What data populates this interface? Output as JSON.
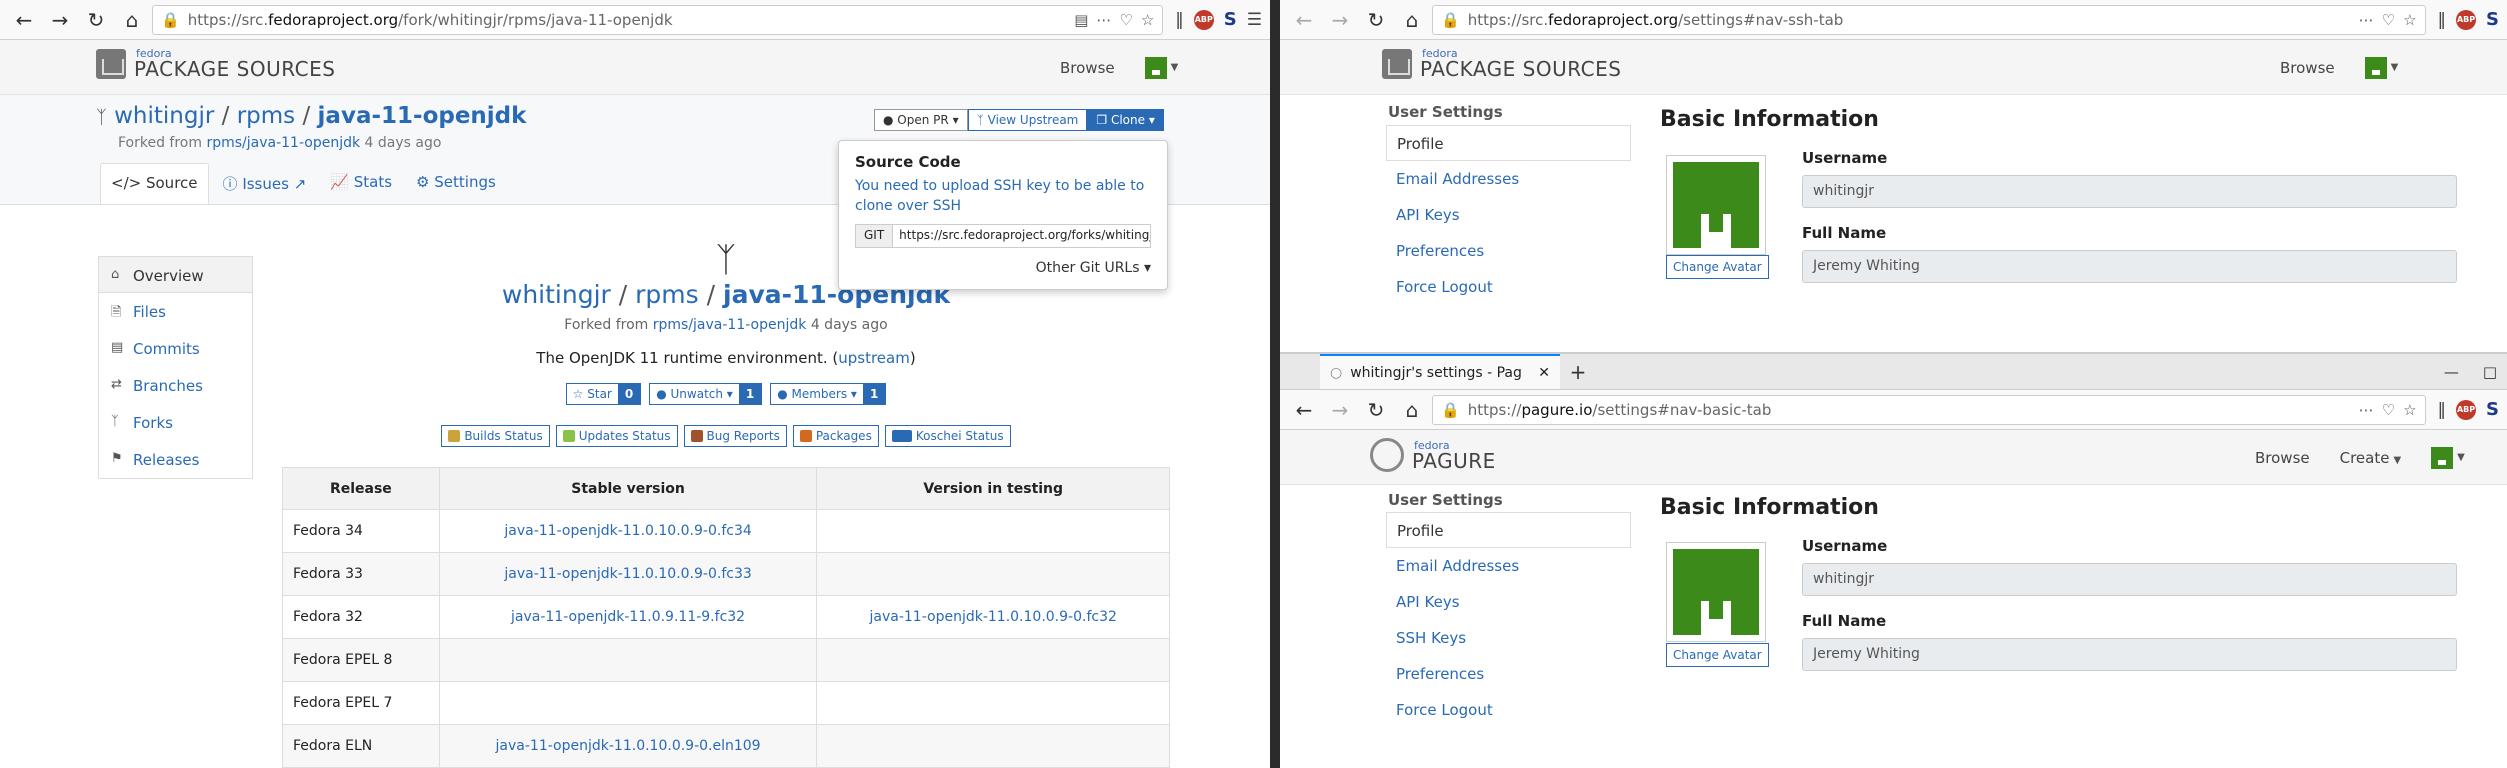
{
  "left": {
    "url_prefix": "https://src.",
    "url_domain": "fedoraproject.org",
    "url_path": "/fork/whitingjr/rpms/java-11-openjdk",
    "logo_small": "fedora",
    "logo_big": "PACKAGE SOURCES",
    "browse": "Browse",
    "repo": {
      "user": "whitingjr",
      "ns": "rpms",
      "name": "java-11-openjdk"
    },
    "forked_from_label": "Forked from",
    "forked_from_link": "rpms/java-11-openjdk",
    "forked_from_age": "4 days ago",
    "tabs": [
      "Source",
      "Issues",
      "Stats",
      "Settings"
    ],
    "buttons": {
      "open_pr": "Open PR",
      "view_upstream": "View Upstream",
      "clone": "Clone"
    },
    "clone_popup": {
      "title": "Source Code",
      "message": "You need to upload SSH key to be able to clone over SSH",
      "git_label": "GIT",
      "git_url": "https://src.fedoraproject.org/forks/whitingjr",
      "other": "Other Git URLs"
    },
    "sidenav": [
      "Overview",
      "Files",
      "Commits",
      "Branches",
      "Forks",
      "Releases"
    ],
    "description": "The OpenJDK 11 runtime environment.",
    "upstream": "upstream",
    "social": [
      {
        "label": "Star",
        "count": "0"
      },
      {
        "label": "Unwatch",
        "count": "1"
      },
      {
        "label": "Members",
        "count": "1"
      }
    ],
    "status_links": [
      "Builds Status",
      "Updates Status",
      "Bug Reports",
      "Packages",
      "Koschei Status"
    ],
    "table": {
      "headers": [
        "Release",
        "Stable version",
        "Version in testing"
      ],
      "rows": [
        [
          "Fedora 34",
          "java-11-openjdk-11.0.10.0.9-0.fc34",
          ""
        ],
        [
          "Fedora 33",
          "java-11-openjdk-11.0.10.0.9-0.fc33",
          ""
        ],
        [
          "Fedora 32",
          "java-11-openjdk-11.0.9.11-9.fc32",
          "java-11-openjdk-11.0.10.0.9-0.fc32"
        ],
        [
          "Fedora EPEL 8",
          "",
          ""
        ],
        [
          "Fedora EPEL 7",
          "",
          ""
        ],
        [
          "Fedora ELN",
          "java-11-openjdk-11.0.10.0.9-0.eln109",
          ""
        ]
      ]
    }
  },
  "right_top": {
    "url_prefix": "https://src.",
    "url_domain": "fedoraproject.org",
    "url_path": "/settings#nav-ssh-tab",
    "logo_small": "fedora",
    "logo_big": "PACKAGE SOURCES",
    "browse": "Browse",
    "user_settings": "User Settings",
    "nav": [
      "Profile",
      "Email Addresses",
      "API Keys",
      "Preferences",
      "Force Logout"
    ],
    "basic_info": "Basic Information",
    "username_label": "Username",
    "username": "whitingjr",
    "fullname_label": "Full Name",
    "fullname": "Jeremy Whiting",
    "change_avatar": "Change Avatar"
  },
  "right_bottom": {
    "tab_title": "whitingjr's settings - Pag",
    "url_prefix": "https://",
    "url_domain": "pagure.io",
    "url_path": "/settings#nav-basic-tab",
    "logo_small": "fedora",
    "logo_big": "PAGURE",
    "browse": "Browse",
    "create": "Create",
    "user_settings": "User Settings",
    "nav": [
      "Profile",
      "Email Addresses",
      "API Keys",
      "SSH Keys",
      "Preferences",
      "Force Logout"
    ],
    "basic_info": "Basic Information",
    "username_label": "Username",
    "username": "whitingjr",
    "fullname_label": "Full Name",
    "fullname": "Jeremy Whiting",
    "change_avatar": "Change Avatar"
  },
  "colors": {
    "link": "#2a6ab5",
    "avatar": "#3c8a1a",
    "tab_accent": "#0a84ff"
  }
}
